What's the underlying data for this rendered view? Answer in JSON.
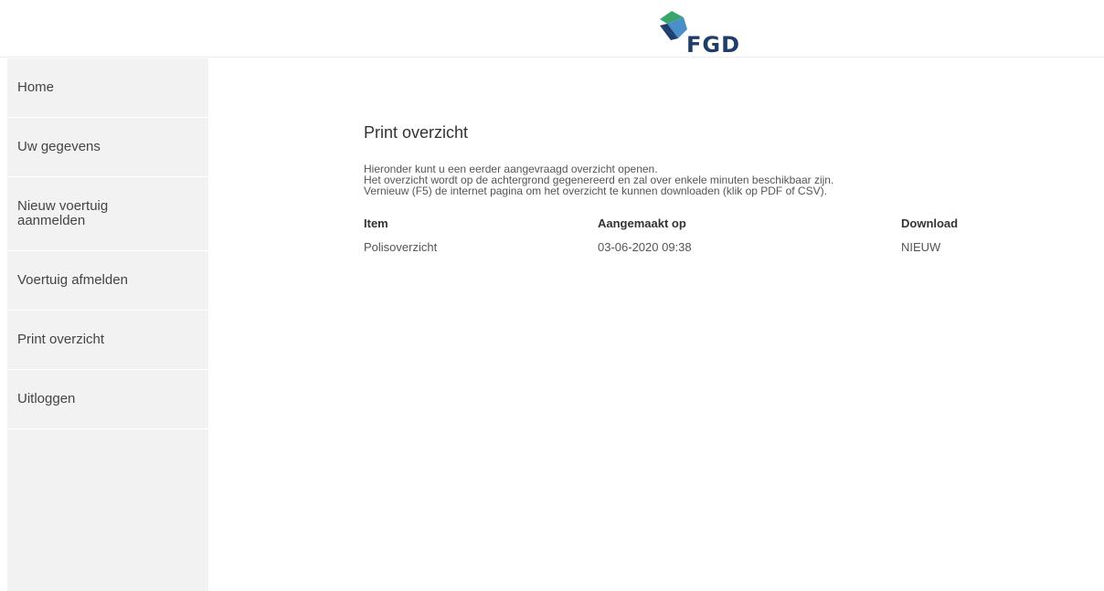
{
  "header": {
    "logo_text": "FGD",
    "logo_colors": {
      "green": "#3aa56b",
      "blue": "#1f3d6b",
      "lightblue": "#4a8fc9"
    }
  },
  "sidebar": {
    "items": [
      {
        "label": "Home"
      },
      {
        "label": "Uw gegevens"
      },
      {
        "label": "Nieuw voertuig aanmelden"
      },
      {
        "label": "Voertuig afmelden"
      },
      {
        "label": "Print overzicht"
      },
      {
        "label": "Uitloggen"
      }
    ]
  },
  "main": {
    "title": "Print overzicht",
    "description": [
      "Hieronder kunt u een eerder aangevraagd overzicht openen.",
      "Het overzicht wordt op de achtergrond gegenereerd en zal over enkele minuten beschikbaar zijn.",
      "Vernieuw (F5) de internet pagina om het overzicht te kunnen downloaden (klik op PDF of CSV)."
    ],
    "table": {
      "headers": [
        "Item",
        "Aangemaakt op",
        "Download"
      ],
      "rows": [
        {
          "item": "Polisoverzicht",
          "created": "03-06-2020 09:38",
          "download": "NIEUW"
        }
      ]
    }
  }
}
